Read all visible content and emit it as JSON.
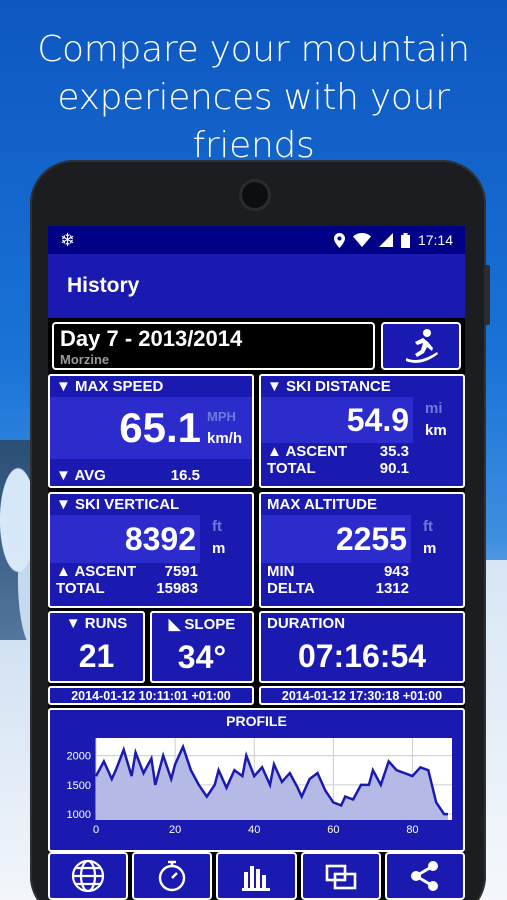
{
  "headline": {
    "line1": "Compare your mountain",
    "line2": "experiences with your friends"
  },
  "statusbar": {
    "app_icon": "snowflake-icon",
    "time": "17:14"
  },
  "appbar": {
    "title": "History"
  },
  "day": {
    "title": "Day 7 - 2013/2014",
    "location": "Morzine",
    "mode_icon": "snowboarder-icon"
  },
  "max_speed": {
    "header": "▼ MAX SPEED",
    "value": "65.1",
    "unit_alt": "MPH",
    "unit": "km/h",
    "avg_label": "▼ AVG",
    "avg_value": "16.5"
  },
  "ski_distance": {
    "header": "▼ SKI DISTANCE",
    "value": "54.9",
    "unit_alt": "mi",
    "unit": "km",
    "ascent_label": "▲ ASCENT",
    "ascent_value": "35.3",
    "total_label": "TOTAL",
    "total_value": "90.1"
  },
  "ski_vertical": {
    "header": "▼ SKI VERTICAL",
    "value": "8392",
    "unit_alt": "ft",
    "unit": "m",
    "ascent_label": "▲ ASCENT",
    "ascent_value": "7591",
    "total_label": "TOTAL",
    "total_value": "15983"
  },
  "max_altitude": {
    "header": "MAX ALTITUDE",
    "value": "2255",
    "unit_alt": "ft",
    "unit": "m",
    "min_label": "MIN",
    "min_value": "943",
    "delta_label": "DELTA",
    "delta_value": "1312"
  },
  "runs": {
    "header": "▼ RUNS",
    "value": "21"
  },
  "slope": {
    "header": "◣ SLOPE",
    "value": "34°"
  },
  "duration": {
    "header": "DURATION",
    "value": "07:16:54"
  },
  "timestamps": {
    "start": "2014-01-12 10:11:01 +01:00",
    "end": "2014-01-12 17:30:18 +01:00"
  },
  "chart_data": {
    "type": "area",
    "title": "PROFILE",
    "xlim": [
      0,
      90
    ],
    "ylim": [
      900,
      2300
    ],
    "xticks": [
      "0",
      "20",
      "40",
      "60",
      "80"
    ],
    "yticks": [
      "1000",
      "1500",
      "2000"
    ],
    "x": [
      0,
      2,
      4,
      5,
      7,
      9,
      10,
      12,
      14,
      15,
      17,
      19,
      20,
      22,
      24,
      26,
      28,
      30,
      31,
      33,
      35,
      37,
      38,
      40,
      42,
      44,
      45,
      47,
      49,
      51,
      52,
      54,
      56,
      58,
      60,
      62,
      63,
      65,
      67,
      69,
      70,
      72,
      74,
      76,
      78,
      80,
      82,
      84,
      86,
      88,
      89
    ],
    "y": [
      1650,
      1900,
      1600,
      1750,
      2100,
      1650,
      2050,
      1700,
      1950,
      1500,
      2000,
      1600,
      1850,
      2150,
      1750,
      1500,
      1300,
      1500,
      1750,
      1450,
      1750,
      1650,
      2000,
      1650,
      1800,
      1500,
      1850,
      1550,
      1700,
      1450,
      1300,
      1600,
      1700,
      1400,
      1200,
      1150,
      1300,
      1250,
      1500,
      1500,
      1750,
      1500,
      1900,
      1750,
      1700,
      1650,
      1800,
      1750,
      1200,
      1000,
      1000
    ]
  },
  "nav": {
    "icons": [
      "globe-icon",
      "stopwatch-icon",
      "bar-chart-icon",
      "windows-icon",
      "share-icon"
    ]
  }
}
